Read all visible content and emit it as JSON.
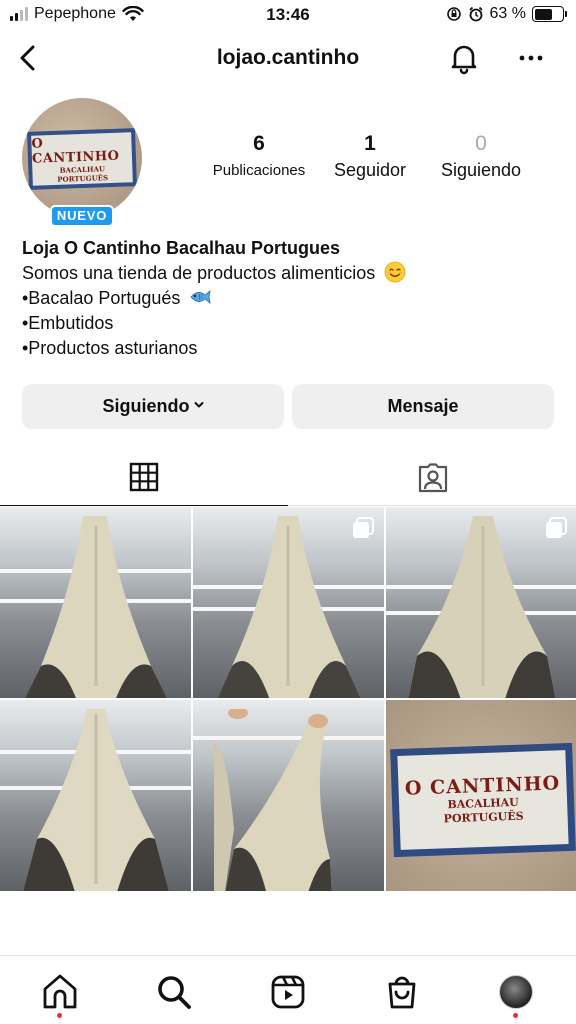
{
  "status_bar": {
    "carrier": "Pepephone",
    "time": "13:46",
    "battery_text": "63 %",
    "battery_level": 0.63
  },
  "header": {
    "username": "lojao.cantinho",
    "icons": [
      "back-icon",
      "bell-icon",
      "more-icon"
    ]
  },
  "profile": {
    "avatar_sign_title": "O CANTINHO",
    "avatar_sign_line1": "BACALHAU",
    "avatar_sign_line2": "PORTUGUÊS",
    "badge": "NUEVO",
    "stats": [
      {
        "value": "6",
        "label": "Publicaciones"
      },
      {
        "value": "1",
        "label": "Seguidor"
      },
      {
        "value": "0",
        "label": "Siguiendo"
      }
    ],
    "name": "Loja O Cantinho Bacalhau Portugues",
    "bio_lines": [
      "Somos una tienda de productos alimenticios",
      "•Bacalao Portugués",
      "•Embutidos",
      "•Productos asturianos"
    ]
  },
  "actions": {
    "following_label": "Siguiendo",
    "message_label": "Mensaje"
  },
  "tabs": [
    "grid-icon",
    "tagged-icon"
  ],
  "posts": [
    {
      "kind": "photo",
      "multi": false
    },
    {
      "kind": "photo",
      "multi": true
    },
    {
      "kind": "photo",
      "multi": true
    },
    {
      "kind": "photo",
      "multi": false
    },
    {
      "kind": "photo",
      "multi": false
    },
    {
      "kind": "logo",
      "multi": false
    }
  ],
  "post_logo": {
    "title": "O CANTINHO",
    "line1": "BACALHAU",
    "line2": "PORTUGUÊS"
  },
  "bottom_nav": [
    "home-icon",
    "search-icon",
    "reels-icon",
    "shop-icon",
    "profile-avatar"
  ],
  "colors": {
    "badge": "#1d9bf0",
    "button_bg": "#efefef",
    "notification_dot": "#ed2a3c"
  }
}
